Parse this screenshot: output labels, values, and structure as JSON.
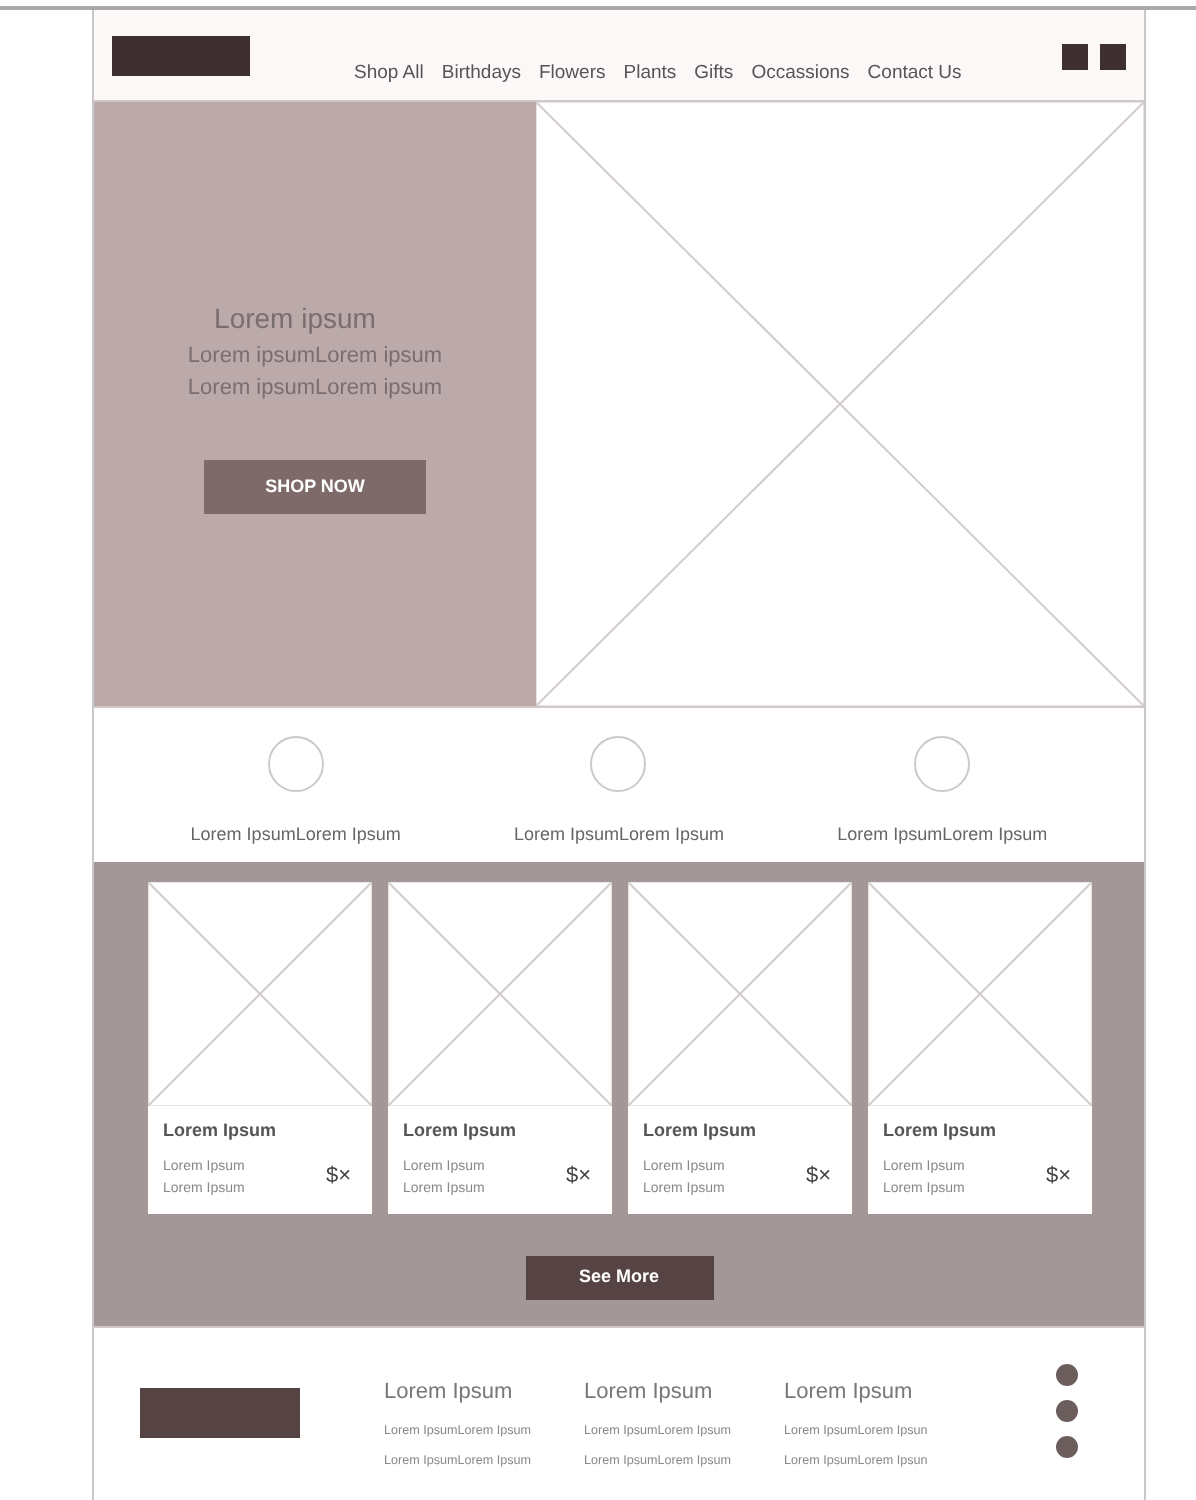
{
  "header": {
    "nav": [
      "Shop All",
      "Birthdays",
      "Flowers",
      "Plants",
      "Gifts",
      "Occassions",
      "Contact Us"
    ]
  },
  "hero": {
    "title": "Lorem ipsum",
    "lines": [
      "Lorem ipsumLorem ipsum",
      "Lorem ipsumLorem ipsum"
    ],
    "button": "SHOP NOW"
  },
  "features": [
    {
      "label": "Lorem IpsumLorem Ipsum"
    },
    {
      "label": "Lorem IpsumLorem Ipsum"
    },
    {
      "label": "Lorem IpsumLorem Ipsum"
    }
  ],
  "products": [
    {
      "title": "Lorem Ipsum",
      "lines": [
        "Lorem Ipsum",
        "Lorem Ipsum"
      ],
      "price": "$×"
    },
    {
      "title": "Lorem Ipsum",
      "lines": [
        "Lorem Ipsum",
        "Lorem Ipsum"
      ],
      "price": "$×"
    },
    {
      "title": "Lorem Ipsum",
      "lines": [
        "Lorem Ipsum",
        "Lorem Ipsum"
      ],
      "price": "$×"
    },
    {
      "title": "Lorem Ipsum",
      "lines": [
        "Lorem Ipsum",
        "Lorem Ipsum"
      ],
      "price": "$×"
    }
  ],
  "see_more": "See More",
  "footer": {
    "columns": [
      {
        "title": "Lorem Ipsum",
        "lines": [
          "Lorem IpsumLorem Ipsum",
          "Lorem IpsumLorem Ipsum"
        ]
      },
      {
        "title": "Lorem Ipsum",
        "lines": [
          "Lorem IpsumLorem Ipsum",
          "Lorem IpsumLorem Ipsum"
        ]
      },
      {
        "title": "Lorem Ipsum",
        "lines": [
          "Lorem IpsumLorem Ipsun",
          "Lorem IpsumLorem Ipsun"
        ]
      }
    ]
  }
}
